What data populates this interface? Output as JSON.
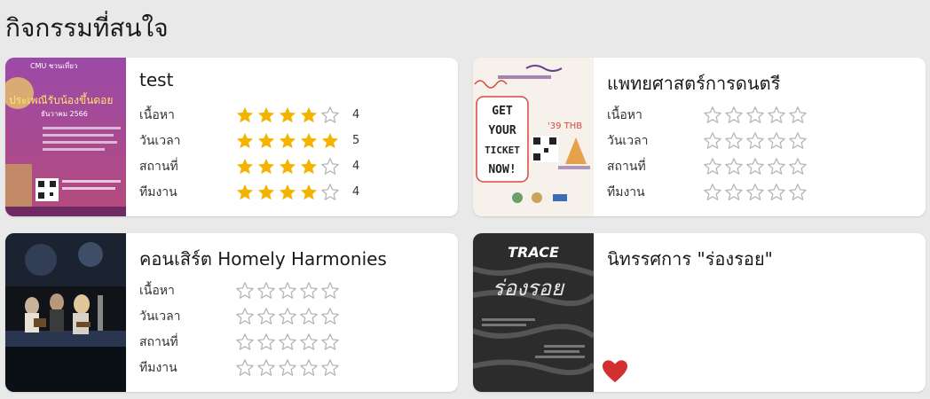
{
  "page": {
    "title": "กิจกรรมที่สนใจ"
  },
  "labels": {
    "content": "เนื้อหา",
    "datetime": "วันเวลา",
    "venue": "สถานที่",
    "team": "ทีมงาน"
  },
  "colors": {
    "star_filled": "#f5b301",
    "star_empty": "#b5b5b5",
    "heart": "#d32f2f"
  },
  "thumbnails": {
    "card1": {
      "texts": [
        "CMU ชวนเที่ยว",
        "ประเพณีรับน้องขึ้นดอย",
        "ธันวาคม 2566"
      ]
    },
    "card2": {
      "texts": [
        "GET",
        "YOUR",
        "TICKET",
        "NOW!",
        "'39 THB"
      ]
    },
    "card4": {
      "texts": [
        "TRACE",
        "ร่องรอย"
      ]
    }
  },
  "cards": [
    {
      "title": "test",
      "scores": [
        4,
        5,
        4,
        4
      ],
      "score_text": [
        "4",
        "5",
        "4",
        "4"
      ]
    },
    {
      "title": "แพทยศาสตร์การดนตรี",
      "scores": [
        0,
        0,
        0,
        0
      ],
      "score_text": [
        "",
        "",
        "",
        ""
      ]
    },
    {
      "title": "คอนเสิร์ต Homely Harmonies",
      "scores": [
        0,
        0,
        0,
        0
      ],
      "score_text": [
        "",
        "",
        "",
        ""
      ]
    },
    {
      "title": "นิทรรศการ \"ร่องรอย\"",
      "favorite": true
    }
  ]
}
